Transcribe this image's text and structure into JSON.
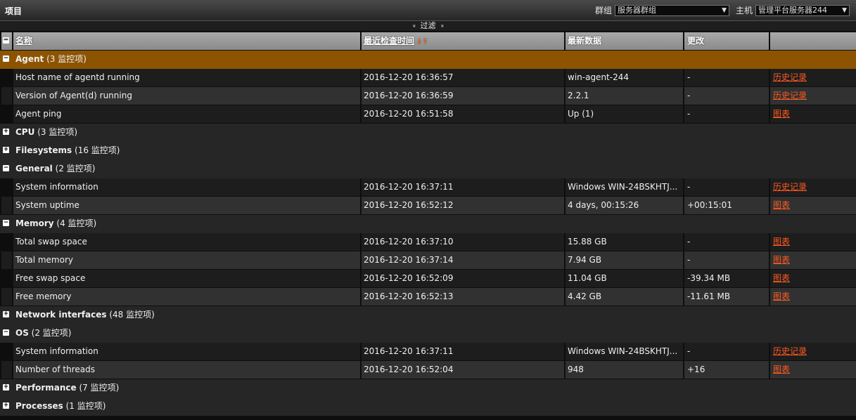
{
  "header": {
    "title": "项目",
    "group_label": "群组",
    "group_value": "服务器群组",
    "host_label": "主机",
    "host_value": "管理平台服务器244",
    "dropdown_arrow": "▼"
  },
  "filter": {
    "label": "过滤",
    "chevron": "»"
  },
  "table": {
    "columns": [
      "名称",
      "最近检查时间",
      "最新数据",
      "更改"
    ],
    "sort_icon": "↓↑",
    "groups": [
      {
        "name": "Agent",
        "count": "(3 监控项)",
        "expanded": true,
        "highlighted": true,
        "items": [
          {
            "name": "Host name of agentd running",
            "time": "2016-12-20 16:36:57",
            "value": "win-agent-244",
            "change": "-",
            "link": "历史记录"
          },
          {
            "name": "Version of Agent(d) running",
            "time": "2016-12-20 16:36:59",
            "value": "2.2.1",
            "change": "-",
            "link": "历史记录"
          },
          {
            "name": "Agent ping",
            "time": "2016-12-20 16:51:58",
            "value": "Up (1)",
            "change": "-",
            "link": "图表"
          }
        ]
      },
      {
        "name": "CPU",
        "count": "(3 监控项)",
        "expanded": false,
        "items": []
      },
      {
        "name": "Filesystems",
        "count": "(16 监控项)",
        "expanded": false,
        "items": []
      },
      {
        "name": "General",
        "count": "(2 监控项)",
        "expanded": true,
        "items": [
          {
            "name": "System information",
            "time": "2016-12-20 16:37:11",
            "value": "Windows WIN-24BSKHTJ...",
            "change": "-",
            "link": "历史记录"
          },
          {
            "name": "System uptime",
            "time": "2016-12-20 16:52:12",
            "value": "4 days, 00:15:26",
            "change": "+00:15:01",
            "link": "图表"
          }
        ]
      },
      {
        "name": "Memory",
        "count": "(4 监控项)",
        "expanded": true,
        "items": [
          {
            "name": "Total swap space",
            "time": "2016-12-20 16:37:10",
            "value": "15.88 GB",
            "change": "-",
            "link": "图表"
          },
          {
            "name": "Total memory",
            "time": "2016-12-20 16:37:14",
            "value": "7.94 GB",
            "change": "-",
            "link": "图表"
          },
          {
            "name": "Free swap space",
            "time": "2016-12-20 16:52:09",
            "value": "11.04 GB",
            "change": "-39.34 MB",
            "link": "图表"
          },
          {
            "name": "Free memory",
            "time": "2016-12-20 16:52:13",
            "value": "4.42 GB",
            "change": "-11.61 MB",
            "link": "图表"
          }
        ]
      },
      {
        "name": "Network interfaces",
        "count": "(48 监控项)",
        "expanded": false,
        "items": []
      },
      {
        "name": "OS",
        "count": "(2 监控项)",
        "expanded": true,
        "items": [
          {
            "name": "System information",
            "time": "2016-12-20 16:37:11",
            "value": "Windows WIN-24BSKHTJ...",
            "change": "-",
            "link": "历史记录"
          },
          {
            "name": "Number of threads",
            "time": "2016-12-20 16:52:04",
            "value": "948",
            "change": "+16",
            "link": "图表"
          }
        ]
      },
      {
        "name": "Performance",
        "count": "(7 监控项)",
        "expanded": false,
        "items": []
      },
      {
        "name": "Processes",
        "count": "(1 监控项)",
        "expanded": false,
        "items": []
      }
    ]
  },
  "colors": {
    "link": "#ff5a1f",
    "highlight_group": "#8c5400"
  }
}
